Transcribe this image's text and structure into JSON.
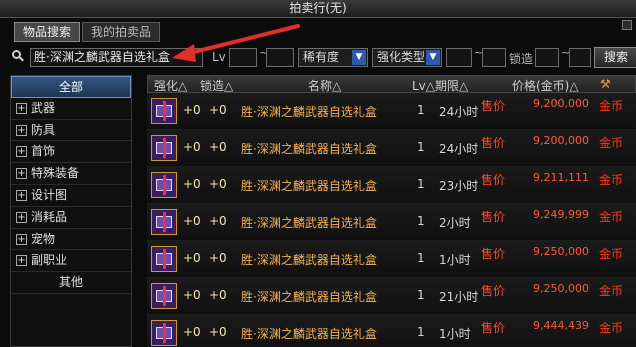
{
  "window": {
    "title": "拍卖行(无)"
  },
  "tabs": [
    {
      "label": "物品搜索",
      "active": true
    },
    {
      "label": "我的拍卖品",
      "active": false
    }
  ],
  "search": {
    "name_value": "胜·深渊之麟武器自选礼盒",
    "lv_label": "Lv",
    "tilde": "~",
    "rarity_label": "稀有度",
    "enhance_type_label": "强化类型",
    "lock_label": "锁造",
    "search_button": "搜索"
  },
  "sidebar": {
    "items": [
      {
        "label": "全部",
        "expandable": false,
        "selected": true
      },
      {
        "label": "武器",
        "expandable": true
      },
      {
        "label": "防具",
        "expandable": true
      },
      {
        "label": "首饰",
        "expandable": true
      },
      {
        "label": "特殊装备",
        "expandable": true
      },
      {
        "label": "设计图",
        "expandable": true
      },
      {
        "label": "消耗品",
        "expandable": true
      },
      {
        "label": "宠物",
        "expandable": true
      },
      {
        "label": "副职业",
        "expandable": true
      },
      {
        "label": "其他",
        "expandable": false
      }
    ]
  },
  "table": {
    "headers": {
      "enhance": "强化△",
      "lock": "锁造△",
      "name": "名称△",
      "lv_period": "Lv△期限△",
      "price": "价格(金币)△"
    },
    "rows": [
      {
        "enhance": "+0",
        "lock": "+0",
        "name": "胜·深渊之麟武器自选礼盒",
        "lv": "1",
        "period": "24小时",
        "sale": "售价",
        "price": "9,200,000",
        "currency": "金币"
      },
      {
        "enhance": "+0",
        "lock": "+0",
        "name": "胜·深渊之麟武器自选礼盒",
        "lv": "1",
        "period": "24小时",
        "sale": "售价",
        "price": "9,200,000",
        "currency": "金币"
      },
      {
        "enhance": "+0",
        "lock": "+0",
        "name": "胜·深渊之麟武器自选礼盒",
        "lv": "1",
        "period": "23小时",
        "sale": "售价",
        "price": "9,211,111",
        "currency": "金币"
      },
      {
        "enhance": "+0",
        "lock": "+0",
        "name": "胜·深渊之麟武器自选礼盒",
        "lv": "1",
        "period": "2小时",
        "sale": "售价",
        "price": "9,249,999",
        "currency": "金币"
      },
      {
        "enhance": "+0",
        "lock": "+0",
        "name": "胜·深渊之麟武器自选礼盒",
        "lv": "1",
        "period": "1小时",
        "sale": "售价",
        "price": "9,250,000",
        "currency": "金币"
      },
      {
        "enhance": "+0",
        "lock": "+0",
        "name": "胜·深渊之麟武器自选礼盒",
        "lv": "1",
        "period": "21小时",
        "sale": "售价",
        "price": "9,250,000",
        "currency": "金币"
      },
      {
        "enhance": "+0",
        "lock": "+0",
        "name": "胜·深渊之麟武器自选礼盒",
        "lv": "1",
        "period": "1小时",
        "sale": "售价",
        "price": "9,444,439",
        "currency": "金币"
      }
    ]
  },
  "colors": {
    "accent_blue": "#2f5aa8",
    "price_red": "#ff4a2a",
    "name_orange": "#f3b15a",
    "annotation_red": "#e0302a"
  },
  "icons": {
    "search": "magnifier-icon",
    "item": "gift-box-icon",
    "annotation": "red-arrow-annotation"
  }
}
